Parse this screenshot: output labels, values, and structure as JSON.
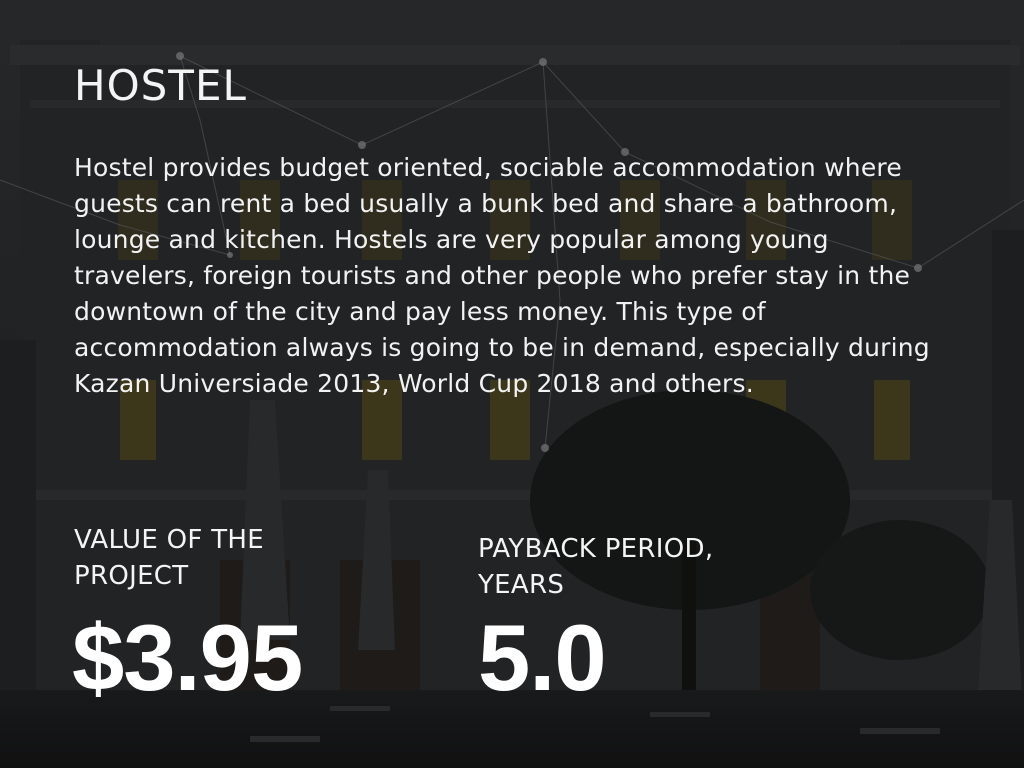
{
  "slide": {
    "title": "HOSTEL",
    "description": "Hostel provides budget oriented, sociable accommodation where guests can rent a bed usually a bunk bed and share a bathroom, lounge and kitchen. Hostels are very popular among young travelers, foreign tourists and other people who prefer stay in the downtown of the city and pay less money. This type of accommodation always is going to be in demand, especially during Kazan Universiade 2013, World Cup 2018 and others."
  },
  "metrics": [
    {
      "label": "VALUE OF THE PROJECT",
      "value": "$3.95"
    },
    {
      "label": "PAYBACK PERIOD, YEARS",
      "value": "5.0"
    }
  ],
  "colors": {
    "background": "#1e2022",
    "text": "#ffffff",
    "window_light": "#b8a93a"
  }
}
